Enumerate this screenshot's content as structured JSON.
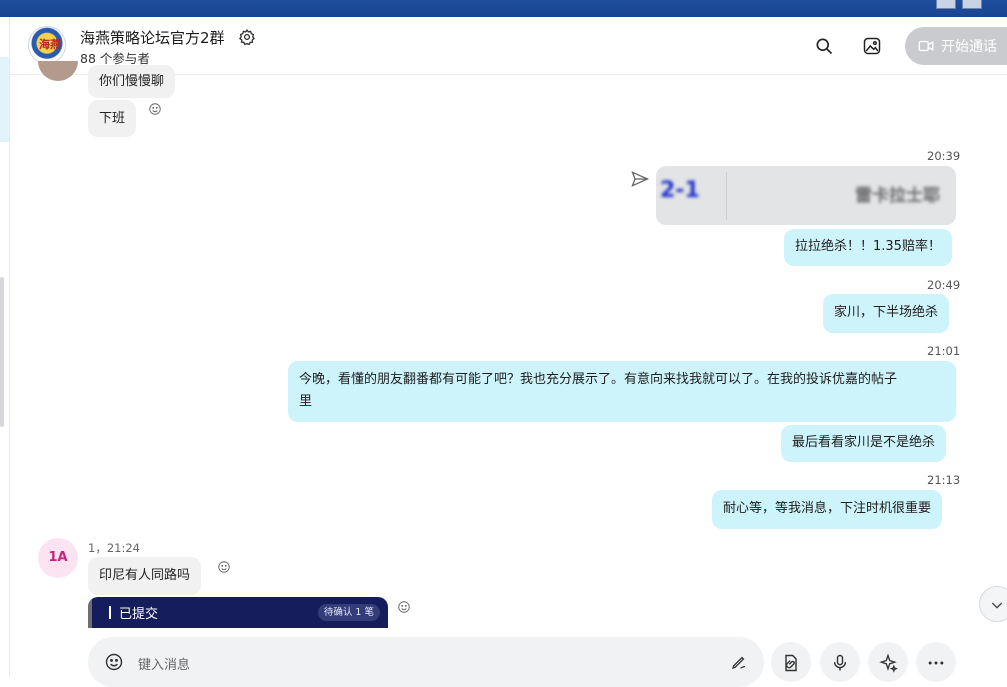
{
  "header": {
    "group_name": "海燕策略论坛官方2群",
    "participants": "88 个参与者",
    "call_button": "开始通话",
    "icons": [
      "settings-gear-icon",
      "search-icon",
      "media-gallery-icon",
      "video-call-icon"
    ]
  },
  "messages": {
    "in_partial": "你们慢慢聊",
    "in_off_work": "下班",
    "time_1": "20:39",
    "image_left_text": "2-1",
    "image_right_text": "雷卡拉士耶",
    "out_1": "拉拉绝杀！！1.35赔率！",
    "time_2": "20:49",
    "out_2": "家川，下半场绝杀",
    "time_3": "21:01",
    "out_3_line1": "今晚，看懂的朋友翻番都有可能了吧？我也充分展示了。有意向来找我就可以了。在我的投诉优嘉的帖子",
    "out_3_line2": "里",
    "out_4": "最后看看家川是不是绝杀",
    "time_4": "21:13",
    "out_5": "耐心等，等我消息，下注时机很重要",
    "sender_avatar": "1A",
    "sender_meta": "1，21:24",
    "in_indonesia": "印尼有人同路吗",
    "shot_title": "已提交",
    "shot_badge": "待确认 1 笔"
  },
  "composer": {
    "placeholder": "键入消息"
  },
  "colors": {
    "outgoing_bubble": "#cdf3fb",
    "incoming_bubble": "#f1f1f2",
    "titlebar": "#1e4f9e"
  }
}
